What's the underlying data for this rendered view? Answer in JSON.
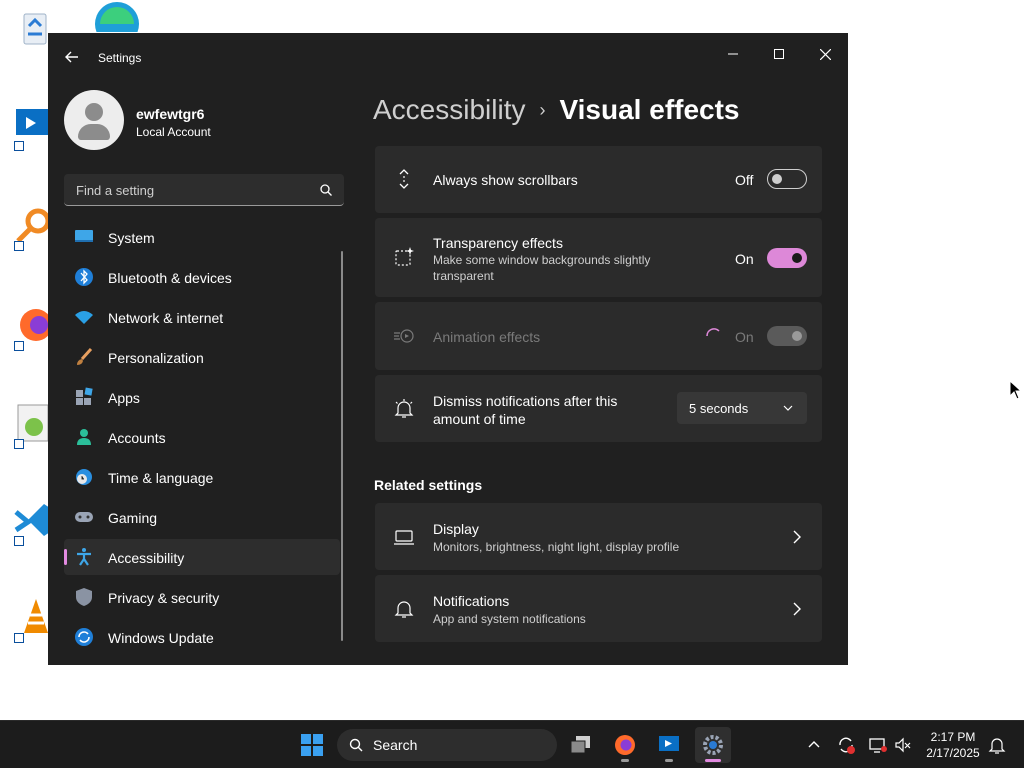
{
  "window": {
    "app_title": "Settings",
    "controls": {
      "minimize": "minimize-icon",
      "maximize": "maximize-icon",
      "close": "close-icon"
    }
  },
  "profile": {
    "name": "ewfewtgr6",
    "account_type": "Local Account"
  },
  "search": {
    "placeholder": "Find a setting"
  },
  "sidebar": {
    "items": [
      {
        "label": "System",
        "icon": "monitor-icon",
        "active": false
      },
      {
        "label": "Bluetooth & devices",
        "icon": "bluetooth-icon",
        "active": false
      },
      {
        "label": "Network & internet",
        "icon": "wifi-icon",
        "active": false
      },
      {
        "label": "Personalization",
        "icon": "brush-icon",
        "active": false
      },
      {
        "label": "Apps",
        "icon": "apps-icon",
        "active": false
      },
      {
        "label": "Accounts",
        "icon": "person-icon",
        "active": false
      },
      {
        "label": "Time & language",
        "icon": "globe-clock-icon",
        "active": false
      },
      {
        "label": "Gaming",
        "icon": "gamepad-icon",
        "active": false
      },
      {
        "label": "Accessibility",
        "icon": "accessibility-icon",
        "active": true
      },
      {
        "label": "Privacy & security",
        "icon": "shield-icon",
        "active": false
      },
      {
        "label": "Windows Update",
        "icon": "update-icon",
        "active": false
      }
    ]
  },
  "breadcrumb": {
    "parent": "Accessibility",
    "separator": "›",
    "current": "Visual effects"
  },
  "settings": {
    "scrollbars": {
      "title": "Always show scrollbars",
      "state": "Off"
    },
    "transparency": {
      "title": "Transparency effects",
      "subtitle": "Make some window backgrounds slightly transparent",
      "state": "On"
    },
    "animation": {
      "title": "Animation effects",
      "state": "On",
      "disabled": true
    },
    "notifications_dismiss": {
      "title": "Dismiss notifications after this amount of time",
      "value": "5 seconds"
    }
  },
  "related": {
    "heading": "Related settings",
    "display": {
      "title": "Display",
      "subtitle": "Monitors, brightness, night light, display profile"
    },
    "notifications": {
      "title": "Notifications",
      "subtitle": "App and system notifications"
    }
  },
  "taskbar": {
    "search_label": "Search",
    "time": "2:17 PM",
    "date": "2/17/2025"
  },
  "colors": {
    "accent": "#dd88d8",
    "window_bg": "#202020",
    "card_bg": "#2b2b2b",
    "taskbar_bg": "#1c1c1c"
  }
}
